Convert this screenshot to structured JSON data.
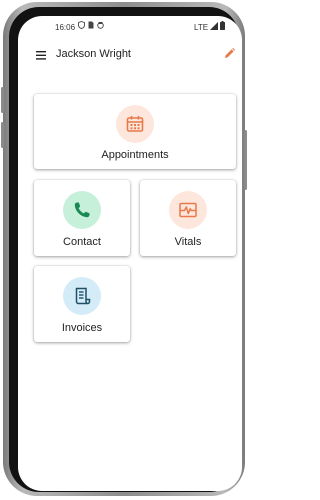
{
  "status_bar": {
    "time": "16:06",
    "network": "LTE"
  },
  "app_bar": {
    "title": "Jackson Wright",
    "menu_icon": "hamburger-menu-icon",
    "edit_icon": "pencil-icon"
  },
  "tiles": [
    {
      "label": "Appointments",
      "icon": "calendar-icon",
      "color": "#e8794a",
      "bg": "#fde7dc"
    },
    {
      "label": "Contact",
      "icon": "phone-icon",
      "color": "#1a8a55",
      "bg": "#c7f0da"
    },
    {
      "label": "Vitals",
      "icon": "vitals-icon",
      "color": "#e8794a",
      "bg": "#fde7dc"
    },
    {
      "label": "Invoices",
      "icon": "receipt-icon",
      "color": "#1f4f66",
      "bg": "#d4ecf7"
    }
  ],
  "colors": {
    "accent": "#e8794a"
  }
}
